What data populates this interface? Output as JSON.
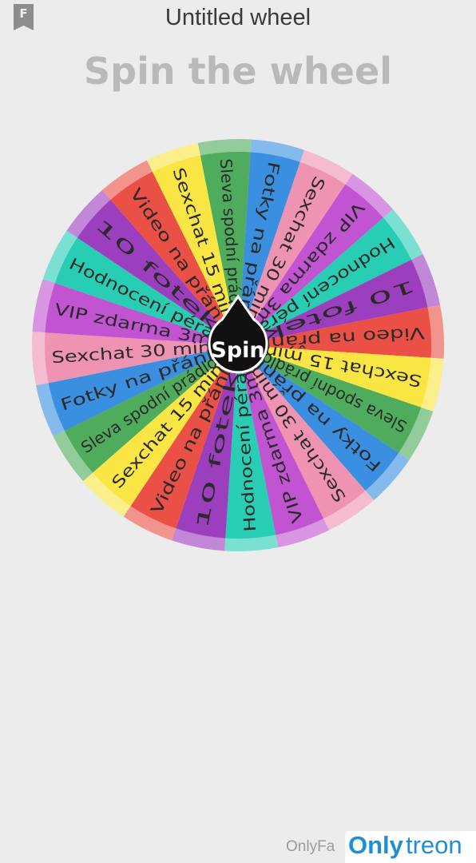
{
  "header": {
    "bookmark_icon": "bookmark-icon",
    "bookmark_letter": "F",
    "title": "Untitled wheel",
    "headline": "Spin the wheel"
  },
  "wheel": {
    "spin_label": "Spin",
    "segments": [
      {
        "label": "Sleva spodní prádlo",
        "color": "#4fac5d"
      },
      {
        "label": "Fotky na přání",
        "color": "#3b8fe0"
      },
      {
        "label": "Sexchat 30 min",
        "color": "#ef93b3"
      },
      {
        "label": "VIP zdarma 3m",
        "color": "#c054d1"
      },
      {
        "label": "Hodnocení péra",
        "color": "#29cdb4"
      },
      {
        "label": "10 fotek",
        "color": "#9c3fbf"
      },
      {
        "label": "Video na přání",
        "color": "#ea5046"
      },
      {
        "label": "Sexchat 15 min",
        "color": "#f9e544"
      },
      {
        "label": "Sleva spodní prádlo",
        "color": "#4fac5d"
      },
      {
        "label": "Fotky na přání",
        "color": "#3b8fe0"
      },
      {
        "label": "Sexchat 30 min",
        "color": "#ef93b3"
      },
      {
        "label": "VIP zdarma 3m",
        "color": "#c054d1"
      },
      {
        "label": "Hodnocení péra",
        "color": "#29cdb4"
      },
      {
        "label": "10 fotek",
        "color": "#9c3fbf"
      },
      {
        "label": "Video na přání",
        "color": "#ea5046"
      },
      {
        "label": "Sexchat 15 min",
        "color": "#f9e544"
      },
      {
        "label": "Sleva spodní prádlo",
        "color": "#4fac5d"
      },
      {
        "label": "Fotky na přání",
        "color": "#3b8fe0"
      },
      {
        "label": "Sexchat 30 min",
        "color": "#ef93b3"
      },
      {
        "label": "VIP zdarma 3m",
        "color": "#c054d1"
      },
      {
        "label": "Hodnocení péra",
        "color": "#29cdb4"
      },
      {
        "label": "10 fotek",
        "color": "#9c3fbf"
      },
      {
        "label": "Video na přání",
        "color": "#ea5046"
      },
      {
        "label": "Sexchat 15 min",
        "color": "#f9e544"
      }
    ]
  },
  "watermark": {
    "prefix": "OnlyFa",
    "brand_bold": "Only",
    "brand_rest": "treon",
    "brand_color": "#1f8fd1"
  }
}
